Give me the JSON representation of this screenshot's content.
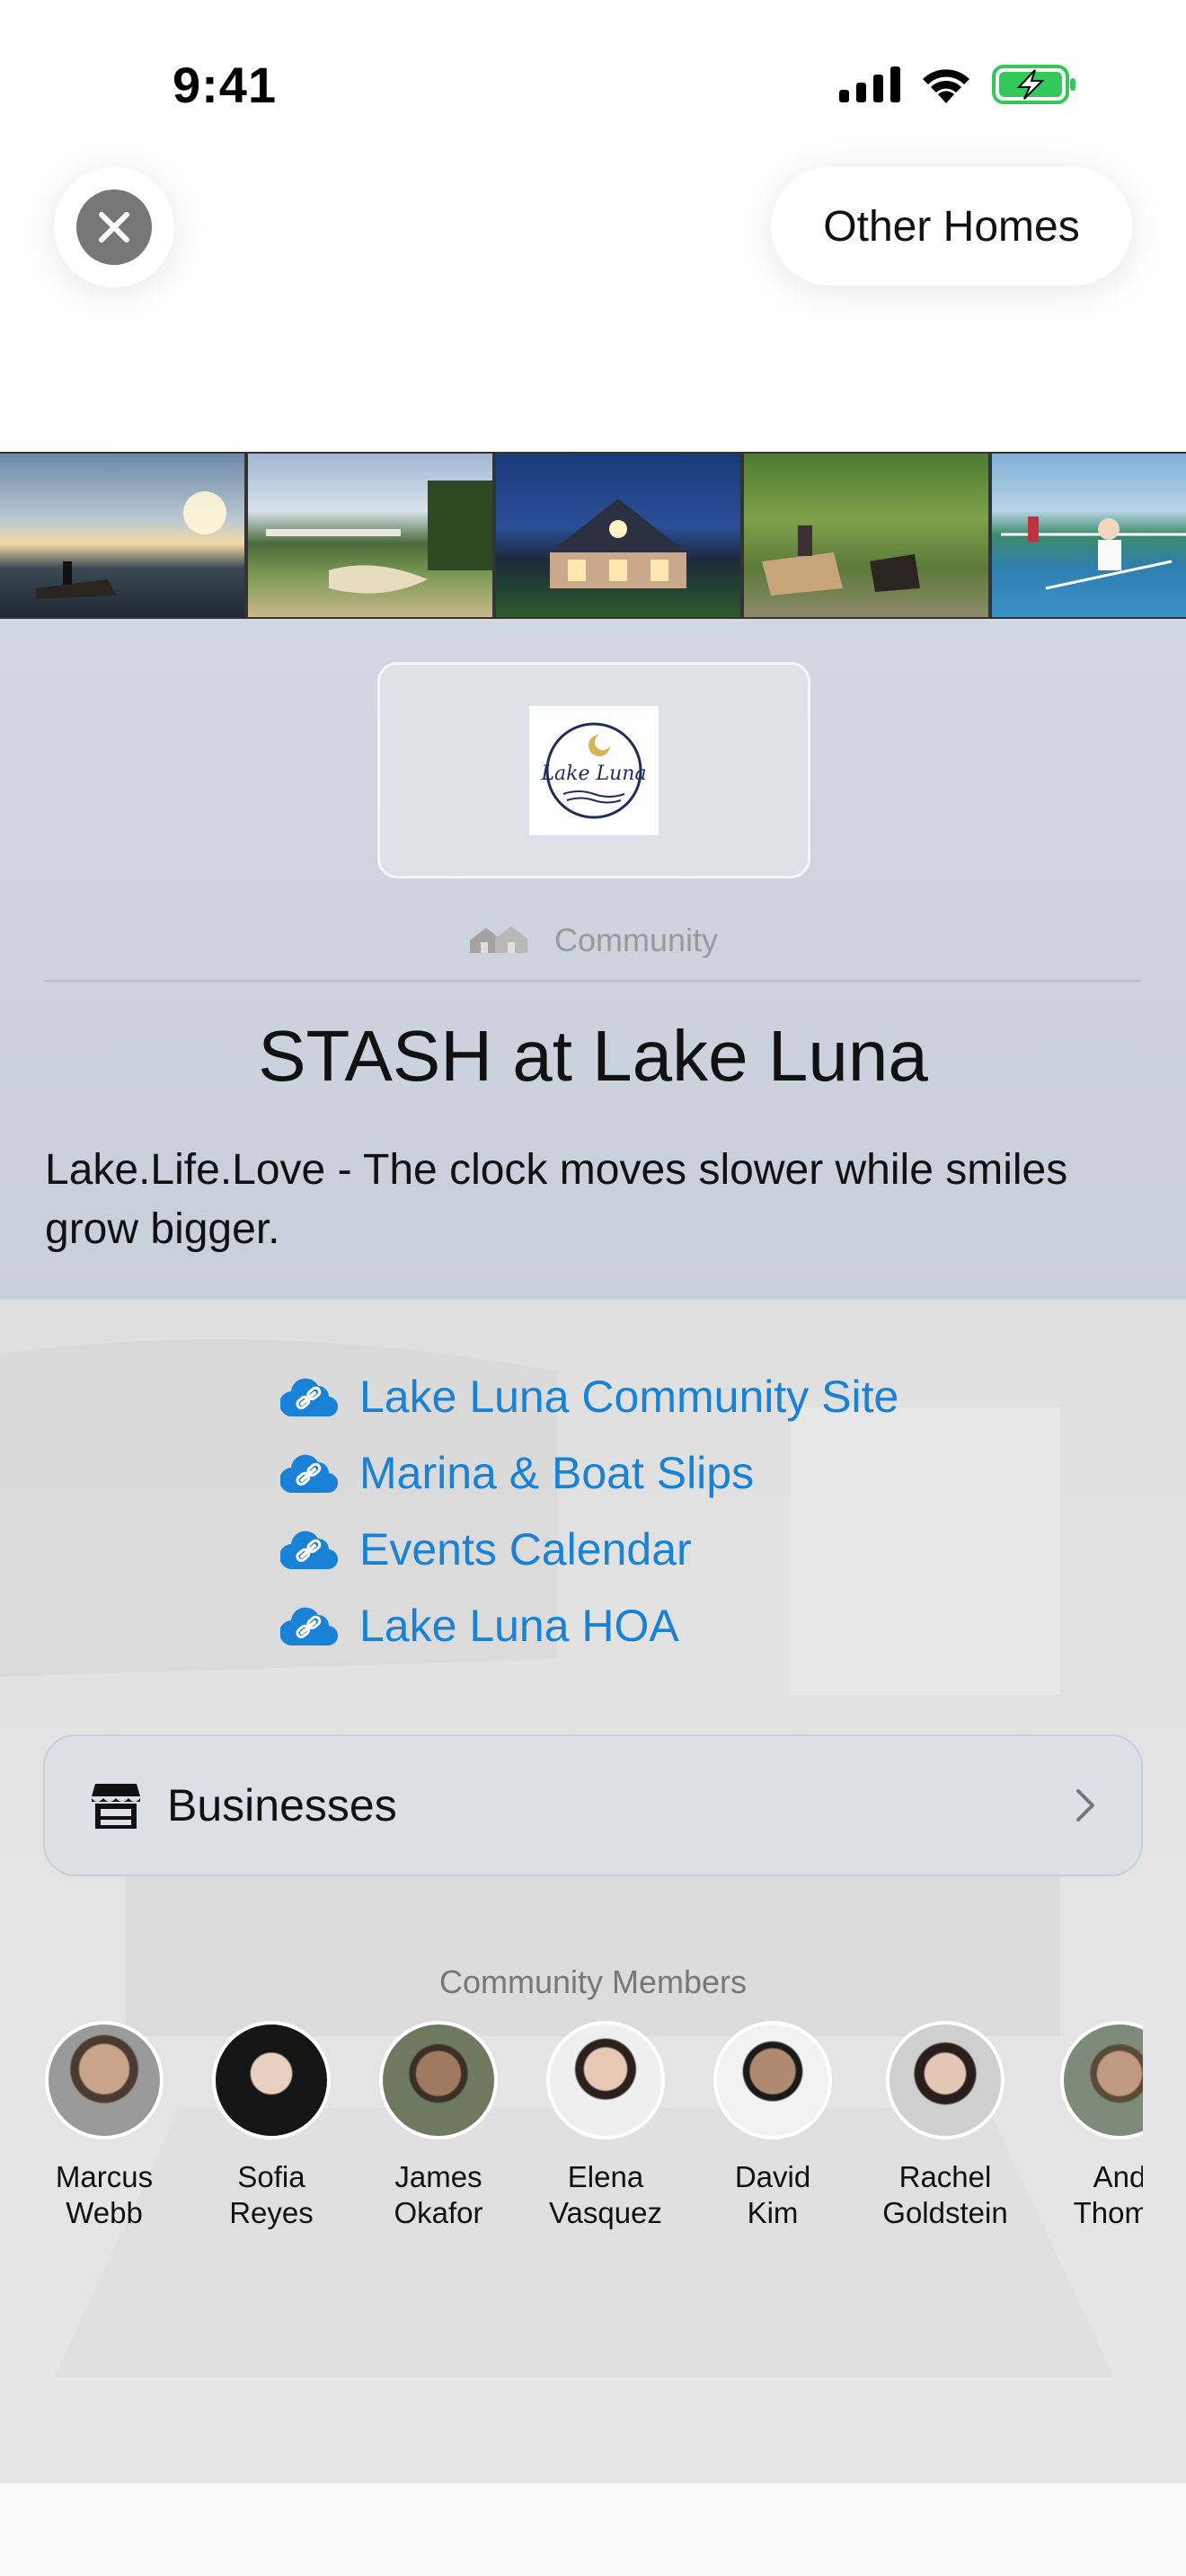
{
  "status_bar": {
    "time": "9:41"
  },
  "header": {
    "other_homes_label": "Other Homes"
  },
  "community": {
    "category_label": "Community",
    "title": "STASH at Lake Luna",
    "description": "Lake.Life.Love - The clock moves slower while smiles grow bigger.",
    "logo_text": "Lake Luna"
  },
  "links": [
    {
      "label": "Lake Luna Community Site"
    },
    {
      "label": "Marina & Boat Slips"
    },
    {
      "label": "Events Calendar"
    },
    {
      "label": "Lake Luna HOA"
    }
  ],
  "businesses": {
    "label": "Businesses"
  },
  "members": {
    "title": "Community Members",
    "people": [
      {
        "first": "Marcus",
        "last": "Webb"
      },
      {
        "first": "Sofia",
        "last": "Reyes"
      },
      {
        "first": "James",
        "last": "Okafor"
      },
      {
        "first": "Elena",
        "last": "Vasquez"
      },
      {
        "first": "David",
        "last": "Kim"
      },
      {
        "first": "Rachel",
        "last": "Goldstein"
      },
      {
        "first": "And",
        "last": "Thomp"
      }
    ]
  },
  "colors": {
    "link": "#1a82d6",
    "battery": "#34c759"
  }
}
